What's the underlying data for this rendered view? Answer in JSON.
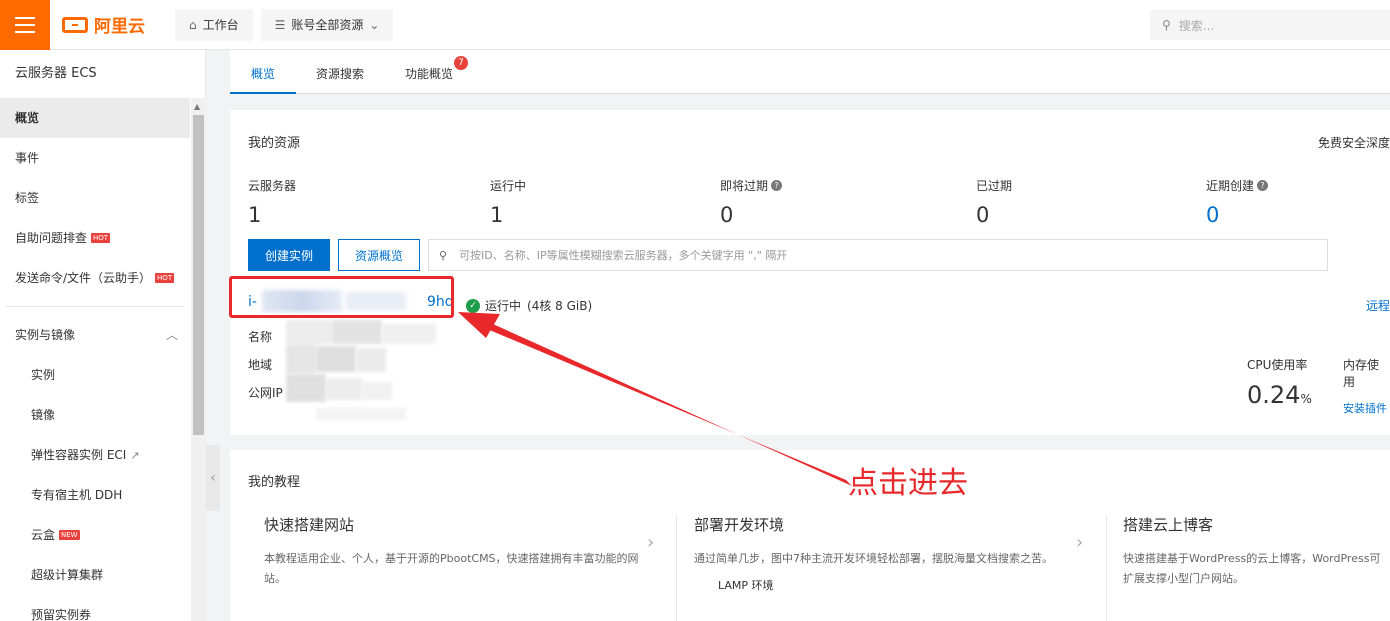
{
  "topbar": {
    "brand": "阿里云",
    "workbench": "工作台",
    "resources": "账号全部资源",
    "search_placeholder": "搜索..."
  },
  "sidebar": {
    "title": "云服务器 ECS",
    "items": [
      {
        "label": "概览"
      },
      {
        "label": "事件"
      },
      {
        "label": "标签"
      },
      {
        "label": "自助问题排查",
        "badge": "HOT"
      },
      {
        "label": "发送命令/文件（云助手）",
        "badge": "HOT"
      }
    ],
    "group": "实例与镜像",
    "sub_items": [
      {
        "label": "实例"
      },
      {
        "label": "镜像"
      },
      {
        "label": "弹性容器实例 ECI"
      },
      {
        "label": "专有宿主机 DDH"
      },
      {
        "label": "云盒",
        "badge": "NEW"
      },
      {
        "label": "超级计算集群"
      },
      {
        "label": "预留实例券"
      }
    ]
  },
  "tabs": [
    {
      "label": "概览"
    },
    {
      "label": "资源搜索"
    },
    {
      "label": "功能概览",
      "badge": "7"
    }
  ],
  "my_resources": {
    "title": "我的资源",
    "right_text": "免费安全深度",
    "stats": [
      {
        "label": "云服务器",
        "value": "1"
      },
      {
        "label": "运行中",
        "value": "1"
      },
      {
        "label": "即将过期",
        "value": "0"
      },
      {
        "label": "已过期",
        "value": "0"
      },
      {
        "label": "近期创建",
        "value": "0"
      }
    ],
    "create_button": "创建实例",
    "overview_button": "资源概览",
    "search_placeholder": "可按ID、名称、IP等属性模糊搜索云服务器，多个关键字用 \",\" 隔开",
    "instance": {
      "id_prefix": "i-",
      "id_suffix": "9hd",
      "status": "运行中",
      "spec": "(4核 8 GiB)",
      "remote": "远程",
      "name_label": "名称",
      "region_label": "地域",
      "ip_label": "公网IP"
    },
    "metrics": [
      {
        "label": "CPU使用率",
        "value": "0.24",
        "unit": "%"
      },
      {
        "label": "内存使用",
        "link": "安装插件"
      }
    ]
  },
  "tutorials": {
    "title": "我的教程",
    "items": [
      {
        "title": "快速搭建网站",
        "desc": "本教程适用企业、个人，基于开源的PbootCMS，快速搭建拥有丰富功能的网站。"
      },
      {
        "title": "部署开发环境",
        "desc": "通过简单几步，图中7种主流开发环境轻松部署，摆脱海量文档搜索之苦。",
        "extra": "LAMP 环境"
      },
      {
        "title": "搭建云上博客",
        "desc": "快速搭建基于WordPress的云上博客，WordPress可扩展支撑小型门户网站。"
      }
    ]
  },
  "annotation": {
    "text": "点击进去",
    "color": "#e8282b"
  },
  "colors": {
    "brand": "#ff6a00",
    "accent": "#0070cc",
    "success": "#1e9e4a",
    "hot": "#e8413c"
  }
}
